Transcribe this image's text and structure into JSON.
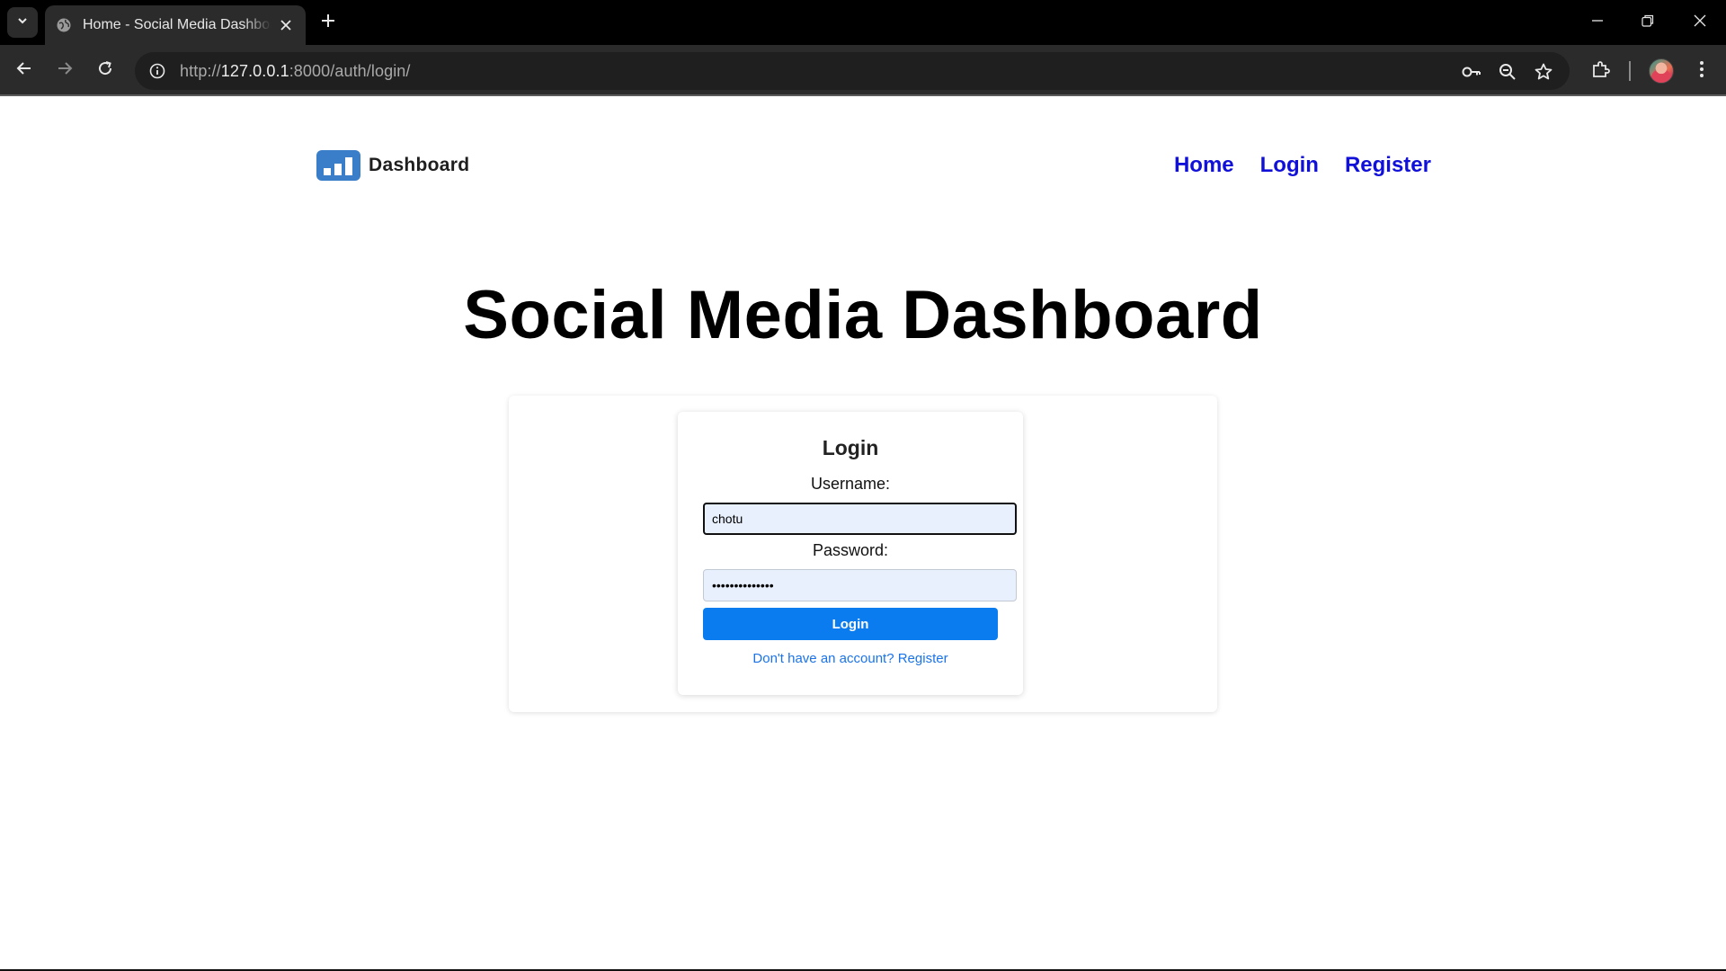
{
  "browser": {
    "tab_title": "Home - Social Media Dashboard",
    "url_prefix": "http://",
    "url_host": "127.0.0.1",
    "url_rest": ":8000/auth/login/",
    "icons": [
      "tab-search-icon",
      "globe-icon",
      "close-icon",
      "plus-icon",
      "minimize-icon",
      "restore-icon",
      "back-icon",
      "forward-icon",
      "reload-icon",
      "info-icon",
      "key-icon",
      "zoom-icon",
      "star-icon",
      "extensions-icon",
      "menu-icon"
    ]
  },
  "header": {
    "logo_text": "Dashboard",
    "nav": [
      "Home",
      "Login",
      "Register"
    ],
    "nav_color": "#1010d8"
  },
  "hero": {
    "title": "Social Media Dashboard"
  },
  "login": {
    "title": "Login",
    "username_label": "Username:",
    "username_value": "chotu",
    "password_label": "Password:",
    "password_value": "••••••••••••••",
    "button_label": "Login",
    "register_link": "Don't have an account? Register",
    "button_color": "#0a7cf0",
    "link_color": "#1a73e8"
  }
}
